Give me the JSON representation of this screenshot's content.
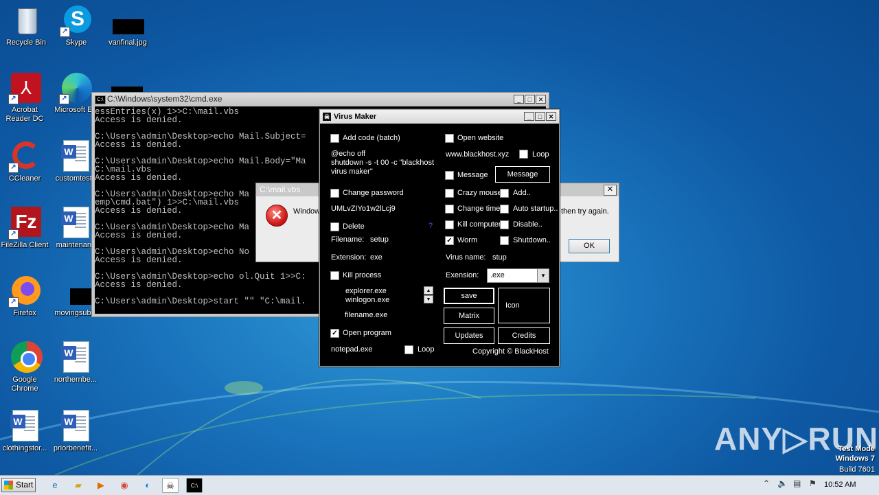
{
  "desktop": {
    "icons": [
      {
        "label": "Recycle Bin"
      },
      {
        "label": "Skype"
      },
      {
        "label": "vanfinal.jpg"
      },
      {
        "label": "Acrobat\nReader DC"
      },
      {
        "label": "Microsoft Ed"
      },
      {
        "label": "CCleaner"
      },
      {
        "label": "customtests"
      },
      {
        "label": "FileZilla Client"
      },
      {
        "label": "maintenanc"
      },
      {
        "label": "Firefox"
      },
      {
        "label": "movingsub"
      },
      {
        "label": "Google\nChrome"
      },
      {
        "label": "northernbe..."
      },
      {
        "label": "clothingstor..."
      },
      {
        "label": "priorbenefit..."
      }
    ]
  },
  "cmd": {
    "title": "C:\\Windows\\system32\\cmd.exe",
    "lines": [
      "essEntries(x) 1>>C:\\mail.vbs",
      "Access is denied.",
      "",
      "C:\\Users\\admin\\Desktop>echo Mail.Subject=",
      "Access is denied.",
      "",
      "C:\\Users\\admin\\Desktop>echo Mail.Body=\"Ma",
      "C:\\mail.vbs",
      "Access is denied.",
      "",
      "C:\\Users\\admin\\Desktop>echo Ma",
      "emp\\cmd.bat\") 1>>C:\\mail.vbs",
      "Access is denied.",
      "",
      "C:\\Users\\admin\\Desktop>echo Ma",
      "Access is denied.",
      "",
      "C:\\Users\\admin\\Desktop>echo No",
      "Access is denied.",
      "",
      "C:\\Users\\admin\\Desktop>echo ol.Quit 1>>C:",
      "Access is denied.",
      "",
      "C:\\Users\\admin\\Desktop>start \"\" \"C:\\mail."
    ]
  },
  "error": {
    "title": "C:\\mail.vbs",
    "msg_left": "Window",
    "msg_right": "then try again.",
    "ok": "OK",
    "close": "✕"
  },
  "virus_maker": {
    "title": "Virus Maker",
    "add_code_label": "Add code (batch)",
    "code_lines": [
      "@echo off",
      "shutdown -s -t 00 -c \"blackhost",
      "virus maker\""
    ],
    "change_password_label": "Change password",
    "password_value": "UMLvZIYo1w2lLcj9",
    "delete_label": "Delete",
    "delete_question": "?",
    "filename_label": "Filename:",
    "filename_value": "setup",
    "extension_label": "Extension:",
    "extension_value": "exe",
    "kill_process_label": "Kill process",
    "process_list": [
      "explorer.exe",
      "winlogon.exe"
    ],
    "process_filename": "filename.exe",
    "open_program_label": "Open program",
    "program_value": "notepad.exe",
    "loop_label": "Loop",
    "open_website_label": "Open website",
    "website_value": "www.blackhost.xyz",
    "message_label": "Message",
    "message_button": "Message",
    "crazy_mouse_label": "Crazy mouse",
    "add_label": "Add..",
    "change_time_label": "Change time",
    "auto_startup_label": "Auto startup..",
    "kill_computer_label": "Kill computer",
    "disable_label": "Disable..",
    "worm_label": "Worm",
    "shutdown_label": "Shutdown..",
    "virus_name_label": "Virus name:",
    "virus_name_value": "stup",
    "exension_label": "Exension:",
    "exension_value": ".exe",
    "save": "save",
    "icon": "Icon",
    "matrix": "Matrix",
    "updates": "Updates",
    "credits": "Credits",
    "copyright": "Copyright © BlackHost",
    "checks": {
      "add_code": false,
      "change_password": false,
      "delete": false,
      "kill_process": false,
      "open_program": true,
      "program_loop": false,
      "open_website": false,
      "website_loop": false,
      "message": false,
      "crazy_mouse": false,
      "add": false,
      "change_time": false,
      "auto_startup": false,
      "kill_computer": false,
      "disable": false,
      "worm": true,
      "shutdown": false
    }
  },
  "watermark": {
    "brand": "ANY▷RUN",
    "test_mode": "Test Mode",
    "os": "Windows 7",
    "build": "Build 7601"
  },
  "taskbar": {
    "start": "Start",
    "clock": "10:52 AM"
  }
}
